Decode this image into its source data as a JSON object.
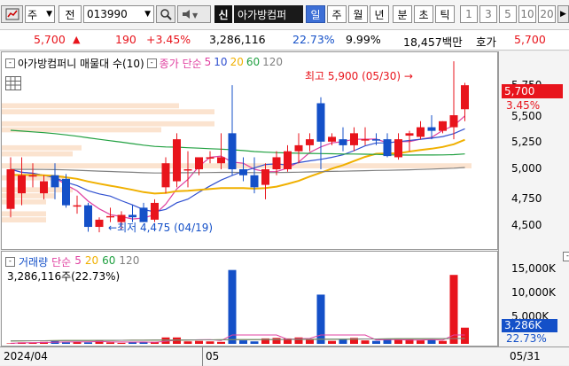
{
  "toolbar": {
    "market": "주",
    "code_prefix": "전",
    "code": "013990",
    "flag": "신",
    "name": "아가방컴퍼",
    "periods": [
      "일",
      "주",
      "월",
      "년",
      "분",
      "초",
      "틱"
    ],
    "active_period": "일",
    "intervals": [
      "1",
      "3",
      "5",
      "10",
      "20"
    ]
  },
  "quote": {
    "price": "5,700",
    "arrow": "▲",
    "change": "190",
    "change_pct": "+3.45%",
    "volume": "3,286,116",
    "volume_pct": "22.73%",
    "turnover": "9.99%",
    "amount": "18,457백만",
    "ask_label": "호가",
    "ask_price": "5,700"
  },
  "price_panel": {
    "title": "아가방컴퍼니 매물대 수(10)",
    "ma_prefix": "종가 단순",
    "ma_periods": [
      "5",
      "10",
      "20",
      "60",
      "120"
    ],
    "high_label": "최고 5,900 (05/30)",
    "low_label": "최저 4,475 (04/19)",
    "axis_labels": [
      "5,750",
      "5,500",
      "5,250",
      "5,000",
      "4,750",
      "4,500"
    ],
    "current_price_tag": "5,700",
    "current_pct_tag": "3.45%"
  },
  "volume_panel": {
    "title": "거래량",
    "ma_prefix": "단순",
    "ma_periods": [
      "5",
      "20",
      "60",
      "120"
    ],
    "info": "3,286,116주(22.73%)",
    "axis_labels": [
      "15,000K",
      "10,000K",
      "5,000K"
    ],
    "current_tag": "3,286K",
    "current_pct_tag": "22.73%"
  },
  "x_axis": {
    "labels": [
      "2024/04",
      "05",
      "05/31"
    ]
  },
  "colors": {
    "up": "#e8141c",
    "down": "#1450c8",
    "ma5": "#e040a0",
    "ma10": "#3050d0",
    "ma20": "#f0b000",
    "ma60": "#20a040",
    "ma120": "#808080",
    "volume_profile": "#fbe3cf"
  },
  "chart_data": {
    "type": "candlestick",
    "candles": [
      {
        "o": 4670,
        "h": 5100,
        "l": 4600,
        "c": 5000
      },
      {
        "o": 4800,
        "h": 5100,
        "l": 4700,
        "c": 4950
      },
      {
        "o": 4950,
        "h": 5050,
        "l": 4850,
        "c": 4950
      },
      {
        "o": 4800,
        "h": 4950,
        "l": 4750,
        "c": 4900
      },
      {
        "o": 4950,
        "h": 5050,
        "l": 4750,
        "c": 4850
      },
      {
        "o": 4920,
        "h": 4960,
        "l": 4680,
        "c": 4700
      },
      {
        "o": 4700,
        "h": 4780,
        "l": 4630,
        "c": 4700
      },
      {
        "o": 4700,
        "h": 4720,
        "l": 4480,
        "c": 4520
      },
      {
        "o": 4520,
        "h": 4600,
        "l": 4475,
        "c": 4580
      },
      {
        "o": 4600,
        "h": 4680,
        "l": 4560,
        "c": 4610
      },
      {
        "o": 4560,
        "h": 4650,
        "l": 4500,
        "c": 4620
      },
      {
        "o": 4620,
        "h": 4700,
        "l": 4560,
        "c": 4600
      },
      {
        "o": 4680,
        "h": 4720,
        "l": 4560,
        "c": 4560
      },
      {
        "o": 4580,
        "h": 4750,
        "l": 4560,
        "c": 4720
      },
      {
        "o": 4850,
        "h": 5100,
        "l": 4800,
        "c": 5050
      },
      {
        "o": 4900,
        "h": 5300,
        "l": 4850,
        "c": 5250
      },
      {
        "o": 5000,
        "h": 5150,
        "l": 4850,
        "c": 5000
      },
      {
        "o": 5000,
        "h": 5100,
        "l": 4950,
        "c": 5100
      },
      {
        "o": 5100,
        "h": 5150,
        "l": 5050,
        "c": 5100
      },
      {
        "o": 5050,
        "h": 5300,
        "l": 5000,
        "c": 5100
      },
      {
        "o": 5300,
        "h": 5700,
        "l": 4950,
        "c": 5000
      },
      {
        "o": 5000,
        "h": 5100,
        "l": 4900,
        "c": 4950
      },
      {
        "o": 4950,
        "h": 5100,
        "l": 4800,
        "c": 4850
      },
      {
        "o": 4870,
        "h": 5050,
        "l": 4750,
        "c": 5000
      },
      {
        "o": 5000,
        "h": 5150,
        "l": 4950,
        "c": 5100
      },
      {
        "o": 5000,
        "h": 5200,
        "l": 4980,
        "c": 5150
      },
      {
        "o": 5150,
        "h": 5300,
        "l": 5050,
        "c": 5200
      },
      {
        "o": 5200,
        "h": 5300,
        "l": 5150,
        "c": 5250
      },
      {
        "o": 5550,
        "h": 5600,
        "l": 5000,
        "c": 5230
      },
      {
        "o": 5230,
        "h": 5300,
        "l": 5200,
        "c": 5270
      },
      {
        "o": 5250,
        "h": 5350,
        "l": 5150,
        "c": 5200
      },
      {
        "o": 5200,
        "h": 5350,
        "l": 5150,
        "c": 5300
      },
      {
        "o": 5250,
        "h": 5350,
        "l": 5200,
        "c": 5250
      },
      {
        "o": 5250,
        "h": 5300,
        "l": 5200,
        "c": 5240
      },
      {
        "o": 5250,
        "h": 5300,
        "l": 5100,
        "c": 5110
      },
      {
        "o": 5100,
        "h": 5300,
        "l": 5080,
        "c": 5250
      },
      {
        "o": 5280,
        "h": 5320,
        "l": 5150,
        "c": 5300
      },
      {
        "o": 5270,
        "h": 5400,
        "l": 5250,
        "c": 5350
      },
      {
        "o": 5350,
        "h": 5450,
        "l": 5250,
        "c": 5320
      },
      {
        "o": 5320,
        "h": 5400,
        "l": 5300,
        "c": 5400
      },
      {
        "o": 5350,
        "h": 5900,
        "l": 5250,
        "c": 5450
      },
      {
        "o": 5500,
        "h": 5720,
        "l": 5400,
        "c": 5700
      }
    ],
    "volume_k": [
      100,
      300,
      300,
      400,
      600,
      300,
      400,
      300,
      700,
      300,
      200,
      300,
      400,
      400,
      1300,
      1300,
      500,
      600,
      500,
      400,
      15000,
      700,
      500,
      1100,
      1200,
      1100,
      1300,
      800,
      10000,
      600,
      900,
      1200,
      700,
      600,
      900,
      800,
      900,
      700,
      900,
      600,
      14000,
      3286
    ],
    "ylim_price": [
      4380,
      5930
    ],
    "ylim_volume_k": [
      0,
      18000
    ],
    "ma_periods": [
      5,
      10,
      20,
      60,
      120
    ]
  }
}
